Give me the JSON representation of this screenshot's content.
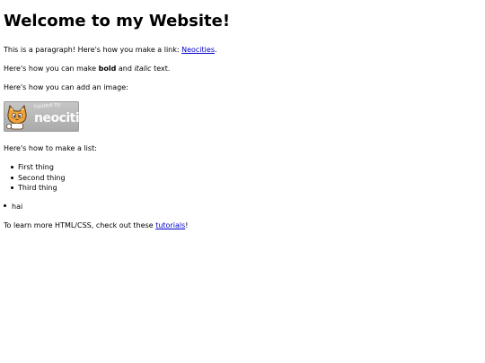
{
  "page": {
    "title": "Welcome to my Website!",
    "paragraph_intro": "This is a paragraph! Here's how you make a link: ",
    "paragraph_link": "Neocities",
    "paragraph_end": ".",
    "format_prefix": "Here's how you can make ",
    "format_bold": "bold",
    "format_mid": " and ",
    "format_italic": "italic",
    "format_suffix": " text.",
    "image_intro": "Here's how you can add an image:",
    "badge": {
      "small_text": "hosted by",
      "big_text": "neocities"
    },
    "list_intro": "Here's how to make a list:",
    "list_items": [
      "First thing",
      "Second thing",
      "Third thing"
    ],
    "extra_item": "hai",
    "footer_prefix": "To learn more HTML/CSS, check out these ",
    "footer_link": "tutorials",
    "footer_suffix": "!"
  },
  "colors": {
    "link": "#0000cc",
    "text": "#000000",
    "background": "#ffffff",
    "badge_bg": "#b8b8b8",
    "badge_cat_fur": "#f0a13a"
  },
  "icons": {
    "badge_mascot": "neocities-cat-icon"
  }
}
